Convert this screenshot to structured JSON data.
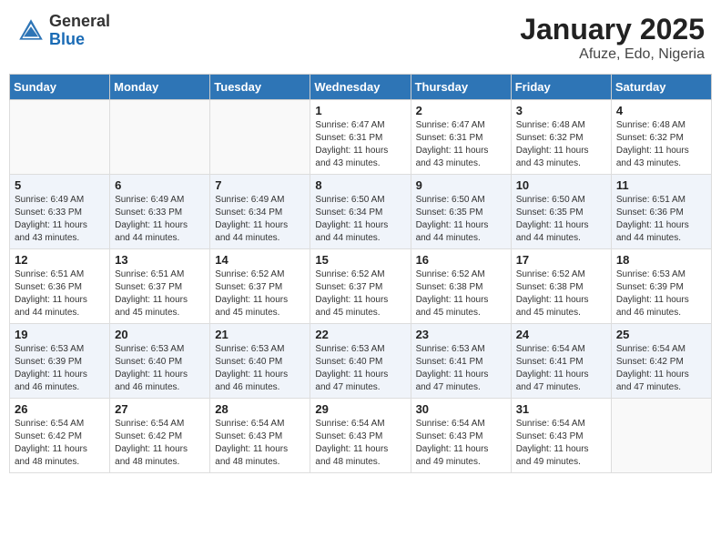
{
  "header": {
    "logo_general": "General",
    "logo_blue": "Blue",
    "month_title": "January 2025",
    "location": "Afuze, Edo, Nigeria"
  },
  "weekdays": [
    "Sunday",
    "Monday",
    "Tuesday",
    "Wednesday",
    "Thursday",
    "Friday",
    "Saturday"
  ],
  "weeks": [
    [
      {
        "day": "",
        "sunrise": "",
        "sunset": "",
        "daylight": ""
      },
      {
        "day": "",
        "sunrise": "",
        "sunset": "",
        "daylight": ""
      },
      {
        "day": "",
        "sunrise": "",
        "sunset": "",
        "daylight": ""
      },
      {
        "day": "1",
        "sunrise": "Sunrise: 6:47 AM",
        "sunset": "Sunset: 6:31 PM",
        "daylight": "Daylight: 11 hours and 43 minutes."
      },
      {
        "day": "2",
        "sunrise": "Sunrise: 6:47 AM",
        "sunset": "Sunset: 6:31 PM",
        "daylight": "Daylight: 11 hours and 43 minutes."
      },
      {
        "day": "3",
        "sunrise": "Sunrise: 6:48 AM",
        "sunset": "Sunset: 6:32 PM",
        "daylight": "Daylight: 11 hours and 43 minutes."
      },
      {
        "day": "4",
        "sunrise": "Sunrise: 6:48 AM",
        "sunset": "Sunset: 6:32 PM",
        "daylight": "Daylight: 11 hours and 43 minutes."
      }
    ],
    [
      {
        "day": "5",
        "sunrise": "Sunrise: 6:49 AM",
        "sunset": "Sunset: 6:33 PM",
        "daylight": "Daylight: 11 hours and 43 minutes."
      },
      {
        "day": "6",
        "sunrise": "Sunrise: 6:49 AM",
        "sunset": "Sunset: 6:33 PM",
        "daylight": "Daylight: 11 hours and 44 minutes."
      },
      {
        "day": "7",
        "sunrise": "Sunrise: 6:49 AM",
        "sunset": "Sunset: 6:34 PM",
        "daylight": "Daylight: 11 hours and 44 minutes."
      },
      {
        "day": "8",
        "sunrise": "Sunrise: 6:50 AM",
        "sunset": "Sunset: 6:34 PM",
        "daylight": "Daylight: 11 hours and 44 minutes."
      },
      {
        "day": "9",
        "sunrise": "Sunrise: 6:50 AM",
        "sunset": "Sunset: 6:35 PM",
        "daylight": "Daylight: 11 hours and 44 minutes."
      },
      {
        "day": "10",
        "sunrise": "Sunrise: 6:50 AM",
        "sunset": "Sunset: 6:35 PM",
        "daylight": "Daylight: 11 hours and 44 minutes."
      },
      {
        "day": "11",
        "sunrise": "Sunrise: 6:51 AM",
        "sunset": "Sunset: 6:36 PM",
        "daylight": "Daylight: 11 hours and 44 minutes."
      }
    ],
    [
      {
        "day": "12",
        "sunrise": "Sunrise: 6:51 AM",
        "sunset": "Sunset: 6:36 PM",
        "daylight": "Daylight: 11 hours and 44 minutes."
      },
      {
        "day": "13",
        "sunrise": "Sunrise: 6:51 AM",
        "sunset": "Sunset: 6:37 PM",
        "daylight": "Daylight: 11 hours and 45 minutes."
      },
      {
        "day": "14",
        "sunrise": "Sunrise: 6:52 AM",
        "sunset": "Sunset: 6:37 PM",
        "daylight": "Daylight: 11 hours and 45 minutes."
      },
      {
        "day": "15",
        "sunrise": "Sunrise: 6:52 AM",
        "sunset": "Sunset: 6:37 PM",
        "daylight": "Daylight: 11 hours and 45 minutes."
      },
      {
        "day": "16",
        "sunrise": "Sunrise: 6:52 AM",
        "sunset": "Sunset: 6:38 PM",
        "daylight": "Daylight: 11 hours and 45 minutes."
      },
      {
        "day": "17",
        "sunrise": "Sunrise: 6:52 AM",
        "sunset": "Sunset: 6:38 PM",
        "daylight": "Daylight: 11 hours and 45 minutes."
      },
      {
        "day": "18",
        "sunrise": "Sunrise: 6:53 AM",
        "sunset": "Sunset: 6:39 PM",
        "daylight": "Daylight: 11 hours and 46 minutes."
      }
    ],
    [
      {
        "day": "19",
        "sunrise": "Sunrise: 6:53 AM",
        "sunset": "Sunset: 6:39 PM",
        "daylight": "Daylight: 11 hours and 46 minutes."
      },
      {
        "day": "20",
        "sunrise": "Sunrise: 6:53 AM",
        "sunset": "Sunset: 6:40 PM",
        "daylight": "Daylight: 11 hours and 46 minutes."
      },
      {
        "day": "21",
        "sunrise": "Sunrise: 6:53 AM",
        "sunset": "Sunset: 6:40 PM",
        "daylight": "Daylight: 11 hours and 46 minutes."
      },
      {
        "day": "22",
        "sunrise": "Sunrise: 6:53 AM",
        "sunset": "Sunset: 6:40 PM",
        "daylight": "Daylight: 11 hours and 47 minutes."
      },
      {
        "day": "23",
        "sunrise": "Sunrise: 6:53 AM",
        "sunset": "Sunset: 6:41 PM",
        "daylight": "Daylight: 11 hours and 47 minutes."
      },
      {
        "day": "24",
        "sunrise": "Sunrise: 6:54 AM",
        "sunset": "Sunset: 6:41 PM",
        "daylight": "Daylight: 11 hours and 47 minutes."
      },
      {
        "day": "25",
        "sunrise": "Sunrise: 6:54 AM",
        "sunset": "Sunset: 6:42 PM",
        "daylight": "Daylight: 11 hours and 47 minutes."
      }
    ],
    [
      {
        "day": "26",
        "sunrise": "Sunrise: 6:54 AM",
        "sunset": "Sunset: 6:42 PM",
        "daylight": "Daylight: 11 hours and 48 minutes."
      },
      {
        "day": "27",
        "sunrise": "Sunrise: 6:54 AM",
        "sunset": "Sunset: 6:42 PM",
        "daylight": "Daylight: 11 hours and 48 minutes."
      },
      {
        "day": "28",
        "sunrise": "Sunrise: 6:54 AM",
        "sunset": "Sunset: 6:43 PM",
        "daylight": "Daylight: 11 hours and 48 minutes."
      },
      {
        "day": "29",
        "sunrise": "Sunrise: 6:54 AM",
        "sunset": "Sunset: 6:43 PM",
        "daylight": "Daylight: 11 hours and 48 minutes."
      },
      {
        "day": "30",
        "sunrise": "Sunrise: 6:54 AM",
        "sunset": "Sunset: 6:43 PM",
        "daylight": "Daylight: 11 hours and 49 minutes."
      },
      {
        "day": "31",
        "sunrise": "Sunrise: 6:54 AM",
        "sunset": "Sunset: 6:43 PM",
        "daylight": "Daylight: 11 hours and 49 minutes."
      },
      {
        "day": "",
        "sunrise": "",
        "sunset": "",
        "daylight": ""
      }
    ]
  ]
}
